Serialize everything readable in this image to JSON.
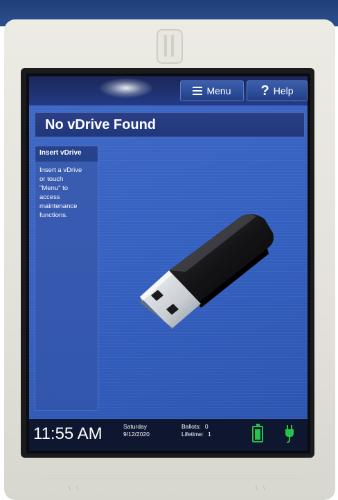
{
  "header": {
    "menu_label": "Menu",
    "help_label": "Help"
  },
  "page": {
    "title": "No vDrive Found"
  },
  "sidebar": {
    "heading": "Insert vDrive",
    "lines": [
      "Insert a vDrive",
      "or touch",
      "\"Menu\" to",
      "access",
      "maintenance",
      "functions."
    ]
  },
  "status": {
    "time": "11:55 AM",
    "day": "Saturday",
    "date": "9/12/2020",
    "ballots_label": "Ballots:",
    "ballots_value": "0",
    "lifetime_label": "Lifetime:",
    "lifetime_value": "1"
  },
  "icons": {
    "menu": "hamburger-menu-icon",
    "help": "question-mark-icon",
    "usb": "usb-drive-image",
    "battery": "battery-icon",
    "power": "power-plug-icon"
  },
  "colors": {
    "screen_blue": "#2f55b3",
    "title_bar": "#22367a",
    "status_bar": "#0f1730",
    "status_green": "#27c24a"
  }
}
